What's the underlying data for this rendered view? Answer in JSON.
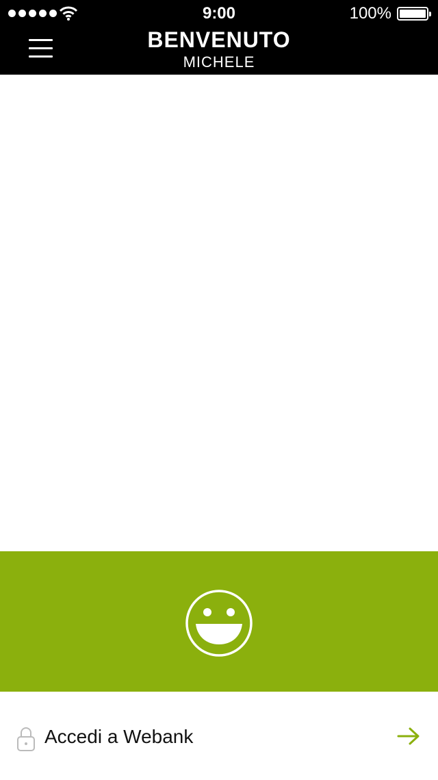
{
  "status_bar": {
    "time": "9:00",
    "battery_percent": "100%",
    "signal_bars": 5,
    "wifi_icon": "wifi-icon",
    "battery_icon": "battery-icon"
  },
  "header": {
    "title": "BENVENUTO",
    "subtitle": "MICHELE",
    "menu_icon": "hamburger-menu-icon"
  },
  "panel": {
    "icon": "smiley-face-icon",
    "color": "#8bb00d"
  },
  "login": {
    "label": "Accedi a Webank",
    "leading_icon": "lock-icon",
    "trailing_icon": "arrow-right-icon",
    "accent": "#8bb00d"
  }
}
